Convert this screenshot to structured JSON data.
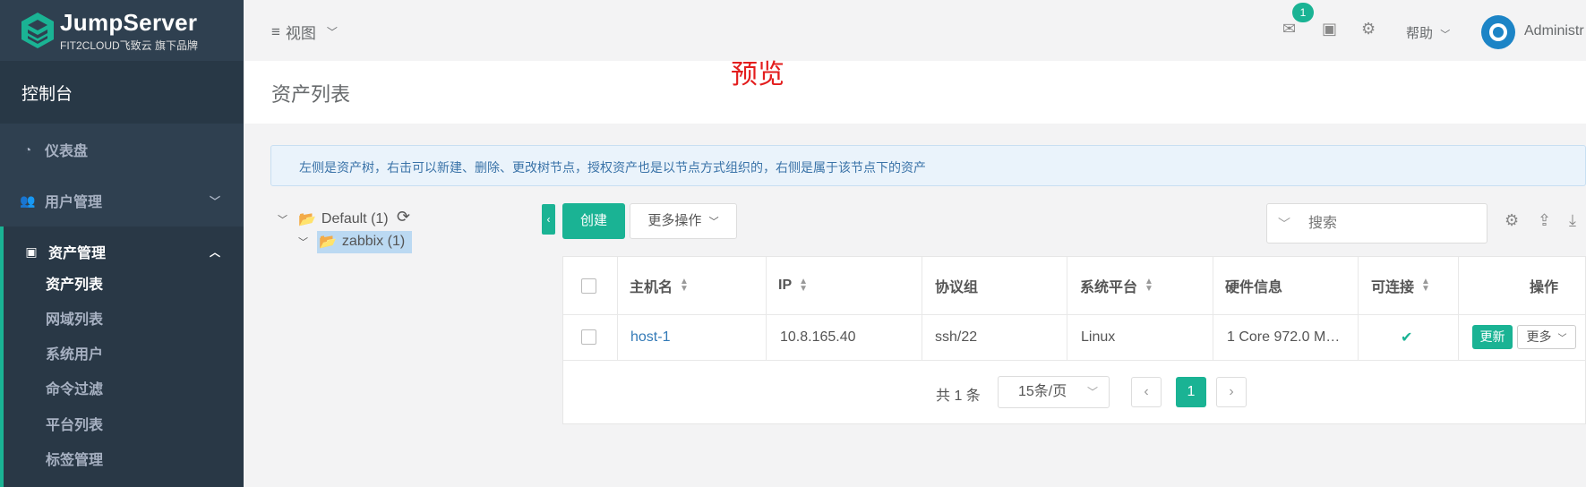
{
  "brand": {
    "name": "JumpServer",
    "subtitle": "FIT2CLOUD飞致云 旗下品牌"
  },
  "sidebar": {
    "console": "控制台",
    "items": [
      {
        "label": "仪表盘",
        "icon": "dashboard-icon"
      },
      {
        "label": "用户管理",
        "icon": "users-icon"
      },
      {
        "label": "资产管理",
        "icon": "inbox-icon"
      }
    ],
    "sub_items": [
      {
        "label": "资产列表"
      },
      {
        "label": "网域列表"
      },
      {
        "label": "系统用户"
      },
      {
        "label": "命令过滤"
      },
      {
        "label": "平台列表"
      },
      {
        "label": "标签管理"
      }
    ]
  },
  "topbar": {
    "view": "视图",
    "notification_count": "1",
    "help": "帮助",
    "user": "Administr"
  },
  "page": {
    "title": "资产列表",
    "watermark": "预览",
    "info": "左侧是资产树，右击可以新建、删除、更改树节点，授权资产也是以节点方式组织的，右侧是属于该节点下的资产"
  },
  "tree": {
    "root": "Default (1)",
    "child": "zabbix (1)"
  },
  "toolbar": {
    "create": "创建",
    "more": "更多操作",
    "search_placeholder": "搜索"
  },
  "table": {
    "headers": [
      "主机名",
      "IP",
      "协议组",
      "系统平台",
      "硬件信息",
      "可连接",
      "操作"
    ],
    "rows": [
      {
        "hostname": "host-1",
        "ip": "10.8.165.40",
        "protocols": "ssh/22",
        "platform": "Linux",
        "hardware": "1 Core 972.0 M…",
        "connectable": true,
        "update": "更新",
        "more": "更多"
      }
    ]
  },
  "pagination": {
    "total": "共 1 条",
    "page_size": "15条/页",
    "current_page": "1"
  },
  "colors": {
    "accent": "#1ab394",
    "sidebar": "#2f4050",
    "watermark": "#e31d1d"
  }
}
